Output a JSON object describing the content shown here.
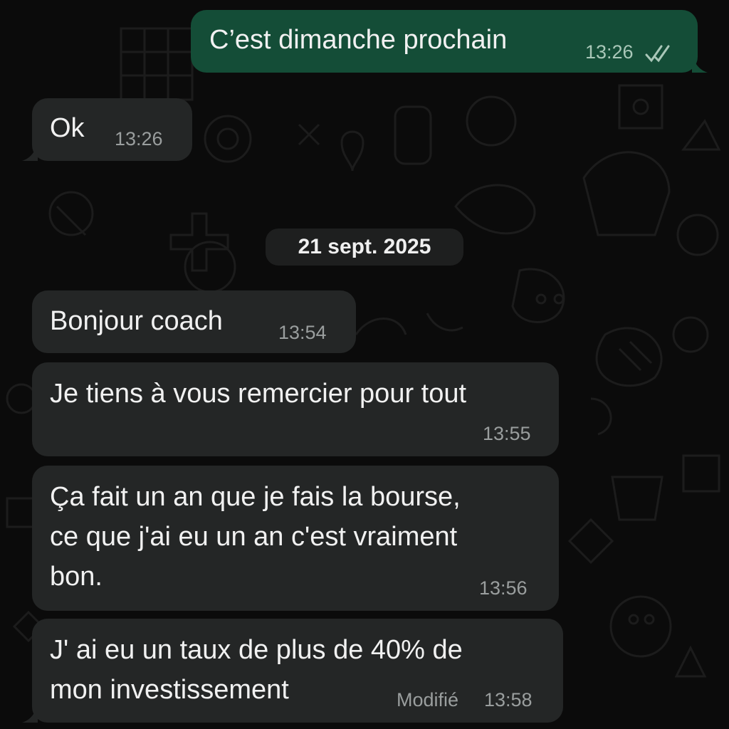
{
  "colors": {
    "background": "#0b0b0b",
    "incoming_bubble": "#242626",
    "outgoing_bubble": "#144d37",
    "text": "#f1f1f1",
    "meta_text": "#9a9e9e"
  },
  "messages": [
    {
      "direction": "outgoing",
      "text": "C’est dimanche prochain",
      "time": "13:26",
      "status_icon": "double-check-icon"
    },
    {
      "direction": "incoming",
      "text": "Ok",
      "time": "13:26"
    },
    {
      "direction": "incoming",
      "text": "Bonjour coach",
      "time": "13:54"
    },
    {
      "direction": "incoming",
      "text": "Je tiens à vous remercier pour tout",
      "time": "13:55"
    },
    {
      "direction": "incoming",
      "lines": [
        "Ça fait un an que je fais la bourse,",
        "ce que j'ai eu un an c'est vraiment",
        "bon."
      ],
      "time": "13:56"
    },
    {
      "direction": "incoming",
      "lines": [
        "J' ai eu un taux de plus de 40% de",
        "mon investissement"
      ],
      "time": "13:58",
      "edited_label": "Modifié"
    }
  ],
  "date_separator": "21 sept. 2025"
}
